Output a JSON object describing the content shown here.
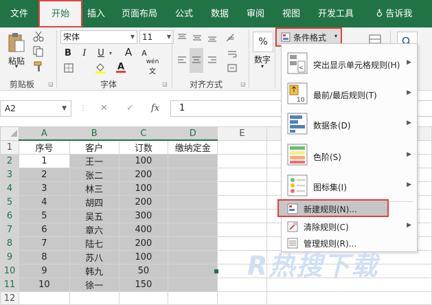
{
  "tabs": [
    "文件",
    "开始",
    "插入",
    "页面布局",
    "公式",
    "数据",
    "审阅",
    "视图",
    "开发工具",
    "告诉我"
  ],
  "clipboard": {
    "paste_label": "粘贴",
    "group_label": "剪贴板"
  },
  "font": {
    "name": "宋体",
    "size": "11",
    "group_label": "字体",
    "bold": "B",
    "italic": "I",
    "underline": "U",
    "a_big": "A",
    "a_small": "A",
    "phonetic": "wén"
  },
  "alignment": {
    "group_label": "对齐方式"
  },
  "number": {
    "label": "数字",
    "percent": "%"
  },
  "conditional_format_button": "条件格式",
  "formula_bar": {
    "name_box": "A2",
    "fx": "fx",
    "value": "1"
  },
  "columns": [
    "A",
    "B",
    "C",
    "D",
    "E"
  ],
  "rows": [
    "1",
    "2",
    "3",
    "4",
    "5",
    "6",
    "7",
    "8",
    "9",
    "10",
    "11",
    "12"
  ],
  "table_headers": [
    "序号",
    "客户",
    "订数",
    "缴纳定金"
  ],
  "table_rows": [
    [
      "1",
      "王一",
      "100",
      ""
    ],
    [
      "2",
      "张二",
      "200",
      ""
    ],
    [
      "3",
      "林三",
      "100",
      ""
    ],
    [
      "4",
      "胡四",
      "200",
      ""
    ],
    [
      "5",
      "吴五",
      "300",
      ""
    ],
    [
      "6",
      "章六",
      "400",
      ""
    ],
    [
      "7",
      "陆七",
      "200",
      ""
    ],
    [
      "8",
      "苏八",
      "100",
      ""
    ],
    [
      "9",
      "韩九",
      "50",
      ""
    ],
    [
      "10",
      "徐一",
      "150",
      ""
    ]
  ],
  "menu": {
    "highlight_rules": "突出显示单元格规则(H)",
    "top_bottom_rules": "最前/最后规则(T)",
    "data_bars": "数据条(D)",
    "color_scales": "色阶(S)",
    "icon_sets": "图标集(I)",
    "new_rule": "新建规则(N)...",
    "clear_rules": "清除规则(C)",
    "manage_rules": "管理规则(R)..."
  },
  "watermark": "R热搜下载",
  "colors": {
    "excel_green": "#217346",
    "highlight_red": "#e0413f",
    "selection_gray": "#c8c8c8"
  }
}
